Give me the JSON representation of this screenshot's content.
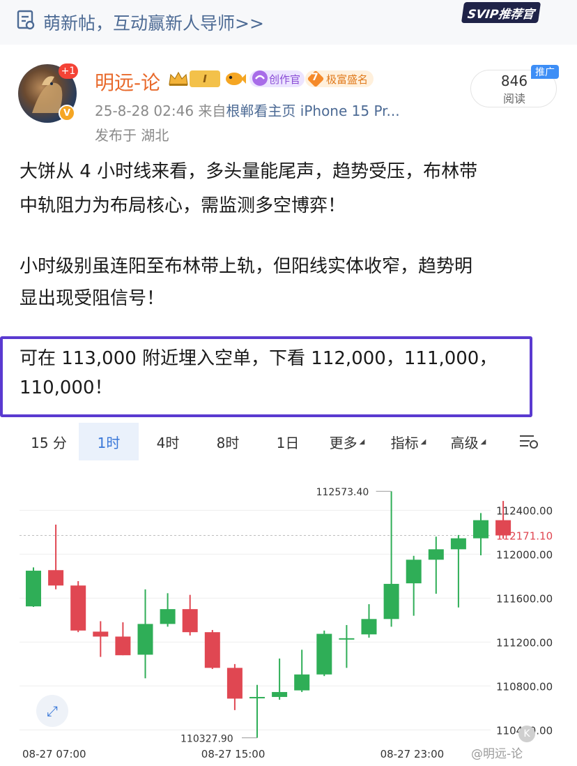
{
  "topbar": {
    "text": "萌新帖，互动赢新人导师>>",
    "badge": "SVIP推荐官"
  },
  "author": {
    "name": "明远-论",
    "avatar_badge": "+1",
    "level": "I",
    "creator_badge": "创作官",
    "rich_level": "7",
    "rich_badge": "极富盛名",
    "time": "25-8-28 02:46",
    "source_prefix": "来自",
    "source": "根郸看主页 iPhone 15 Pr...",
    "location": "发布于 湖北"
  },
  "stats": {
    "views": "846",
    "views_label": "阅读",
    "promo": "推广"
  },
  "post": {
    "p1_line1": "大饼从 4 小时线来看，多头量能尾声，趋势受压，布林带",
    "p1_line2": "中轨阻力为布局核心，需监测多空博弈！",
    "p2_line1": "小时级别虽连阳至布林带上轨，但阳线实体收窄，趋势明",
    "p2_line2": "显出现受阻信号！",
    "p3_line1": "可在 113,000 附近埋入空单，下看 112,000，111,000，",
    "p3_line2": "110,000！"
  },
  "chart_tabs": [
    {
      "label": "15 分",
      "active": false
    },
    {
      "label": "1时",
      "active": true
    },
    {
      "label": "4时",
      "active": false
    },
    {
      "label": "8时",
      "active": false
    },
    {
      "label": "1日",
      "active": false
    },
    {
      "label": "更多",
      "active": false
    },
    {
      "label": "指标",
      "active": false
    },
    {
      "label": "高级",
      "active": false
    }
  ],
  "chart_settings_icon": "chart-settings-icon",
  "colors": {
    "up": "#2fae57",
    "down": "#e04752",
    "accent": "#3a78d8",
    "highlight_border": "#5a3ad0",
    "username": "#e8692b"
  },
  "chart_data": {
    "type": "candlestick",
    "ylim": [
      110300,
      112600
    ],
    "y_ticks": [
      "112400.00",
      "112000.00",
      "111600.00",
      "111200.00",
      "110800.00",
      "110400.00"
    ],
    "y_tick_values": [
      112400,
      112000,
      111600,
      111200,
      110800,
      110400
    ],
    "x_ticks": [
      "08-27 07:00",
      "08-27 15:00",
      "08-27 23:00"
    ],
    "x_tick_index": [
      0,
      8,
      16
    ],
    "current_price": "112171.10",
    "current_price_value": 112171.1,
    "high_label": "112573.40",
    "high_index": 16,
    "low_label": "110327.90",
    "low_index": 10,
    "candles": [
      {
        "o": 111525,
        "h": 111880,
        "l": 111520,
        "c": 111850
      },
      {
        "o": 111855,
        "h": 112270,
        "l": 111680,
        "c": 111715
      },
      {
        "o": 111715,
        "h": 111755,
        "l": 111290,
        "c": 111305
      },
      {
        "o": 111295,
        "h": 111390,
        "l": 111065,
        "c": 111250
      },
      {
        "o": 111250,
        "h": 111380,
        "l": 111080,
        "c": 111080
      },
      {
        "o": 111085,
        "h": 111680,
        "l": 110870,
        "c": 111365
      },
      {
        "o": 111365,
        "h": 111645,
        "l": 111340,
        "c": 111500
      },
      {
        "o": 111500,
        "h": 111630,
        "l": 111260,
        "c": 111290
      },
      {
        "o": 111290,
        "h": 111310,
        "l": 110955,
        "c": 110965
      },
      {
        "o": 110965,
        "h": 111000,
        "l": 110580,
        "c": 110685
      },
      {
        "o": 110690,
        "h": 110810,
        "l": 110328,
        "c": 110700
      },
      {
        "o": 110700,
        "h": 111050,
        "l": 110675,
        "c": 110745
      },
      {
        "o": 110760,
        "h": 111130,
        "l": 110745,
        "c": 110905
      },
      {
        "o": 110905,
        "h": 111305,
        "l": 110890,
        "c": 111275
      },
      {
        "o": 111235,
        "h": 111355,
        "l": 110965,
        "c": 111235
      },
      {
        "o": 111270,
        "h": 111545,
        "l": 111240,
        "c": 111410
      },
      {
        "o": 111410,
        "h": 112573,
        "l": 111340,
        "c": 111730
      },
      {
        "o": 111735,
        "h": 111985,
        "l": 111440,
        "c": 111950
      },
      {
        "o": 111950,
        "h": 112160,
        "l": 111640,
        "c": 112045
      },
      {
        "o": 112045,
        "h": 112175,
        "l": 111515,
        "c": 112145
      },
      {
        "o": 112145,
        "h": 112375,
        "l": 111990,
        "c": 112310
      },
      {
        "o": 112310,
        "h": 112485,
        "l": 112140,
        "c": 112171
      }
    ]
  },
  "watermark": "@明远-论"
}
